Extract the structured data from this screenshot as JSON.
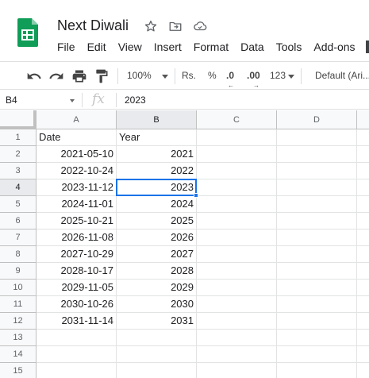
{
  "document": {
    "title": "Next Diwali",
    "menus": [
      "File",
      "Edit",
      "View",
      "Insert",
      "Format",
      "Data",
      "Tools",
      "Add-ons"
    ]
  },
  "toolbar": {
    "zoom": "100%",
    "currency": "Rs.",
    "percent": "%",
    "decrease_decimal": ".0",
    "increase_decimal": ".00",
    "number_format": "123",
    "font": "Default (Ari..."
  },
  "formula_bar": {
    "cell_ref": "B4",
    "fx": "fx",
    "value": "2023"
  },
  "sheet": {
    "columns": [
      "A",
      "B",
      "C",
      "D"
    ],
    "active_cell": "B4",
    "rows": [
      {
        "num": "1",
        "a": "Date",
        "b": "Year"
      },
      {
        "num": "2",
        "a": "2021-05-10",
        "b": "2021"
      },
      {
        "num": "3",
        "a": "2022-10-24",
        "b": "2022"
      },
      {
        "num": "4",
        "a": "2023-11-12",
        "b": "2023"
      },
      {
        "num": "5",
        "a": "2024-11-01",
        "b": "2024"
      },
      {
        "num": "6",
        "a": "2025-10-21",
        "b": "2025"
      },
      {
        "num": "7",
        "a": "2026-11-08",
        "b": "2026"
      },
      {
        "num": "8",
        "a": "2027-10-29",
        "b": "2027"
      },
      {
        "num": "9",
        "a": "2028-10-17",
        "b": "2028"
      },
      {
        "num": "10",
        "a": "2029-11-05",
        "b": "2029"
      },
      {
        "num": "11",
        "a": "2030-10-26",
        "b": "2030"
      },
      {
        "num": "12",
        "a": "2031-11-14",
        "b": "2031"
      },
      {
        "num": "13",
        "a": "",
        "b": ""
      },
      {
        "num": "14",
        "a": "",
        "b": ""
      },
      {
        "num": "15",
        "a": "",
        "b": ""
      }
    ]
  },
  "colors": {
    "logo_green": "#0f9d58",
    "selection_blue": "#1a73e8",
    "header_bg": "#f8f9fa",
    "active_header_bg": "#e8eaed"
  }
}
